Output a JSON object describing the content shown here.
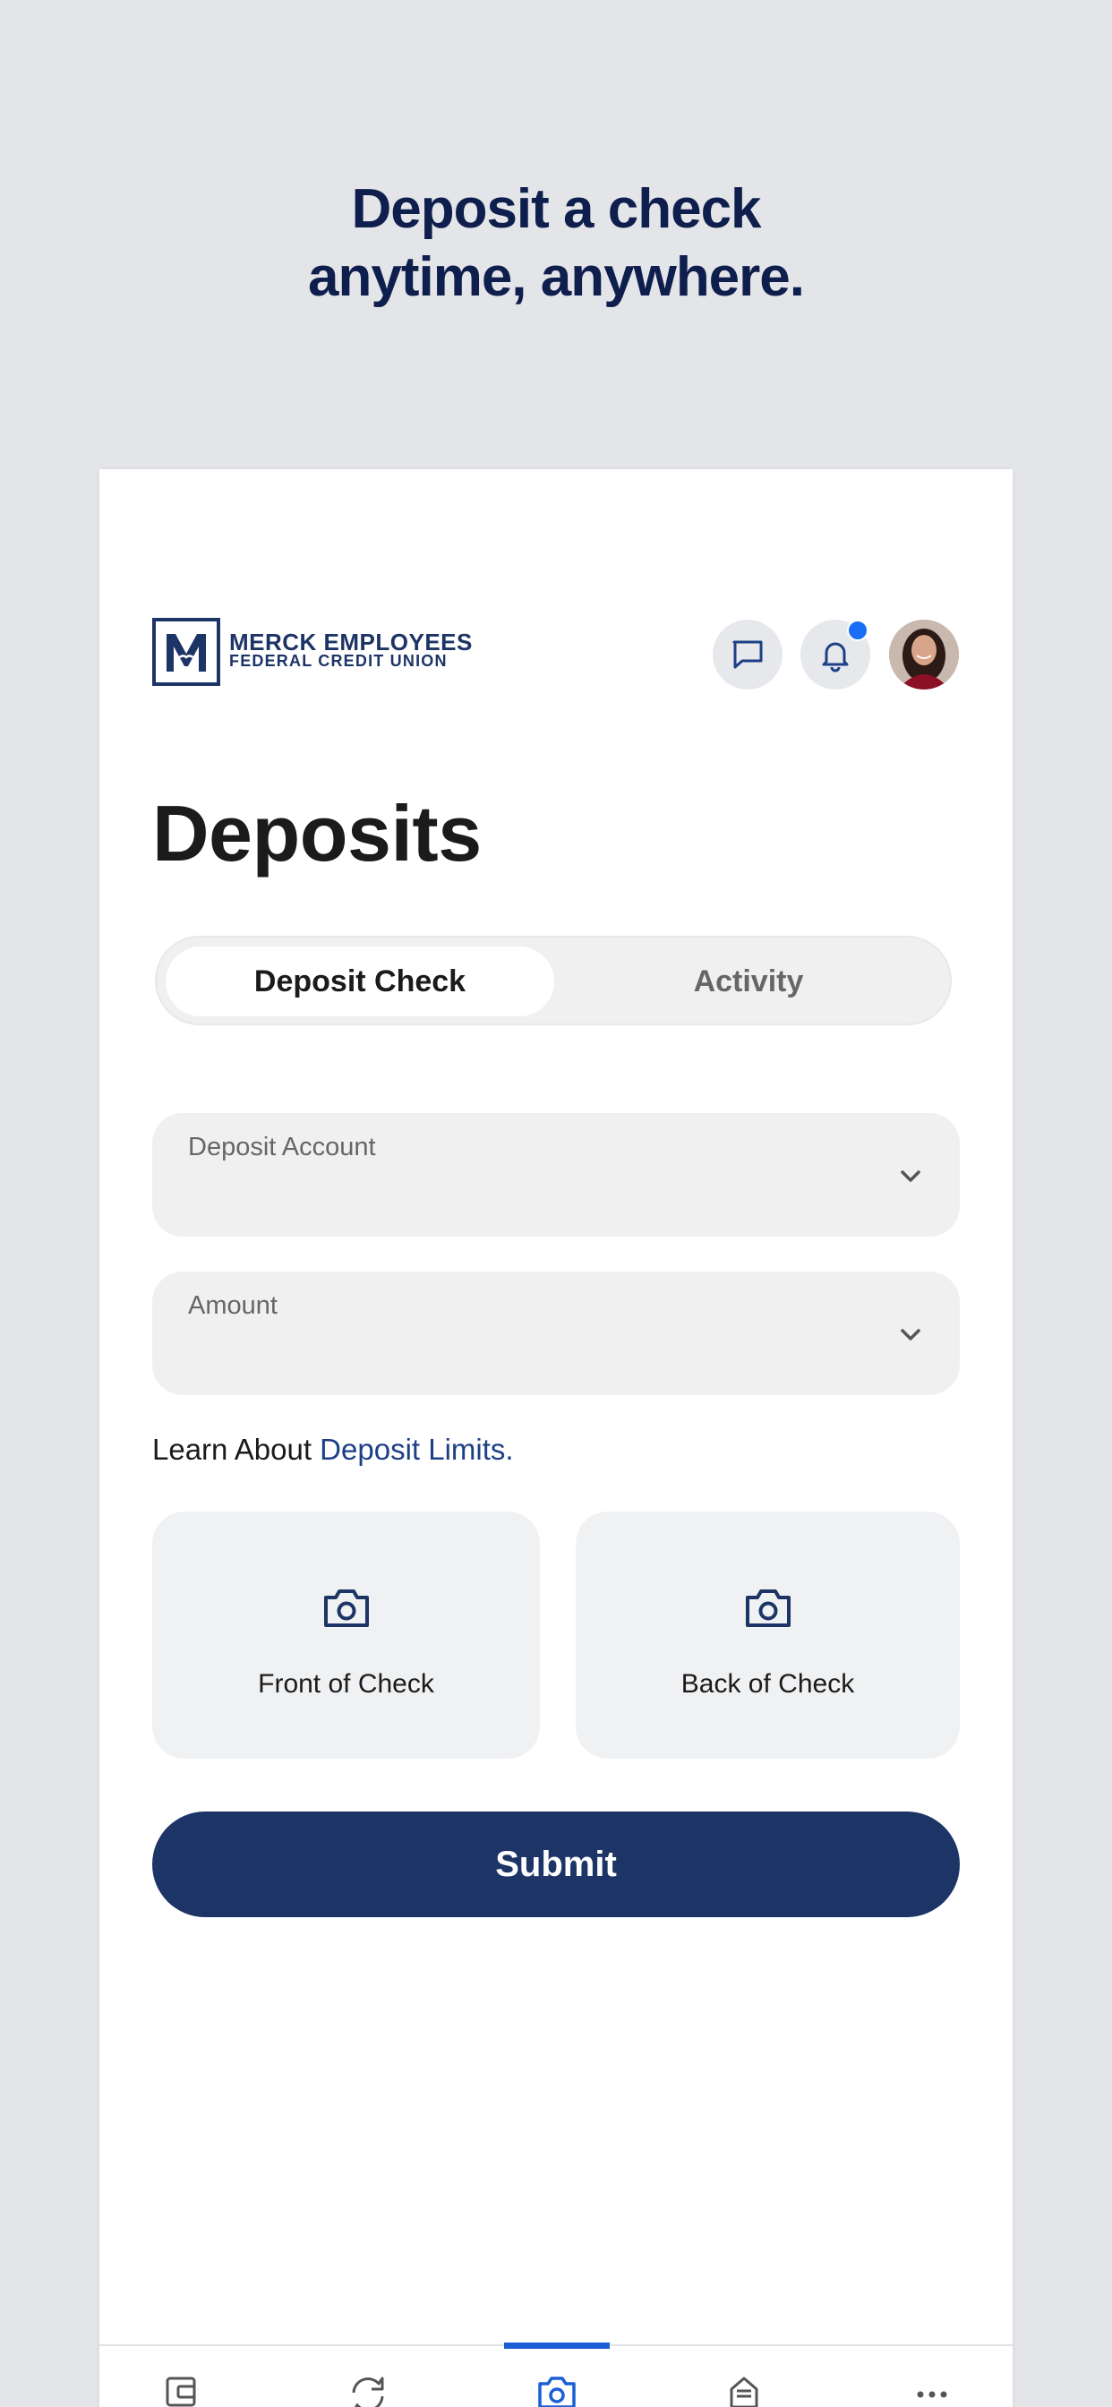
{
  "promo": {
    "line1": "Deposit a check",
    "line2": "anytime, anywhere."
  },
  "header": {
    "logo_line1": "MERCK EMPLOYEES",
    "logo_line2": "FEDERAL CREDIT UNION",
    "icons": [
      "chat-icon",
      "bell-icon",
      "avatar"
    ],
    "has_notification": true
  },
  "page": {
    "title": "Deposits"
  },
  "tabs": [
    {
      "label": "Deposit Check",
      "active": true
    },
    {
      "label": "Activity",
      "active": false
    }
  ],
  "form": {
    "account_label": "Deposit Account",
    "amount_label": "Amount",
    "learn_prefix": "Learn About",
    "learn_link": "Deposit Limits."
  },
  "capture": {
    "front_label": "Front of Check",
    "back_label": "Back of Check"
  },
  "submit_label": "Submit",
  "bottom_nav": [
    {
      "icon": "wallet-icon",
      "active": false
    },
    {
      "icon": "transfer-icon",
      "active": false
    },
    {
      "icon": "camera-icon",
      "active": true
    },
    {
      "icon": "bill-icon",
      "active": false
    },
    {
      "icon": "more-icon",
      "active": false
    }
  ],
  "colors": {
    "brand_navy": "#1d3466",
    "headline_navy": "#0f1f4d",
    "accent_blue": "#1a5fd6",
    "background": "#e4e5e9"
  }
}
